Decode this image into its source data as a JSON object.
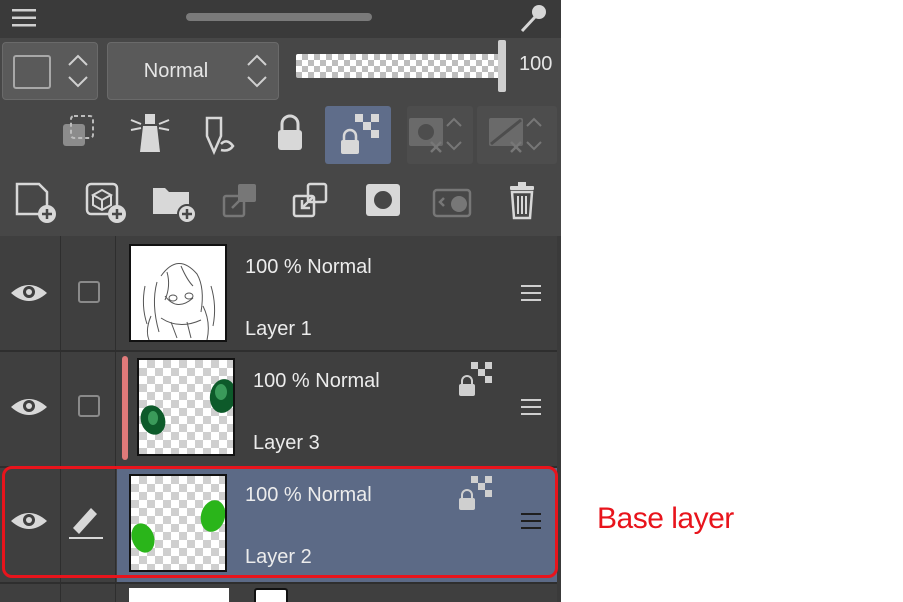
{
  "toolbar": {
    "blend_mode": "Normal",
    "opacity_value": "100",
    "opacity_level_percent": 100
  },
  "icons_row1": [
    "layer-color-box",
    "blend-mode-stepper",
    "opacity-slider"
  ],
  "icons_row2": [
    "ruler-clip-icon",
    "lighthouse-reference-icon",
    "lock-paint-icon",
    "lock-icon",
    "lock-transparent-pixels-icon",
    "mask-options-icon",
    "ruler-options-icon"
  ],
  "icons_row3": [
    "new-raster-layer-icon",
    "new-3d-layer-icon",
    "new-folder-icon",
    "transfer-down-icon",
    "combine-layers-icon",
    "mask-icon",
    "apply-mask-icon",
    "delete-layer-icon"
  ],
  "layers": [
    {
      "opacity_blend": "100 % Normal",
      "name": "Layer 1",
      "lock_transparent": false,
      "clipped": false,
      "selected": false,
      "editing": false
    },
    {
      "opacity_blend": "100 % Normal",
      "name": "Layer 3",
      "lock_transparent": true,
      "clipped": true,
      "selected": false,
      "editing": false
    },
    {
      "opacity_blend": "100 % Normal",
      "name": "Layer 2",
      "lock_transparent": true,
      "clipped": false,
      "selected": true,
      "editing": true
    }
  ],
  "annotation": {
    "label": "Base layer",
    "color": "#e8141c"
  },
  "colors": {
    "panel_bg": "#3e3e3e",
    "selected_row": "#5c6a86",
    "active_button": "#5f6d8a",
    "clip_indicator": "#e07a7a",
    "green_dark": "#0d5a2a",
    "green_bright": "#2ab51a"
  }
}
